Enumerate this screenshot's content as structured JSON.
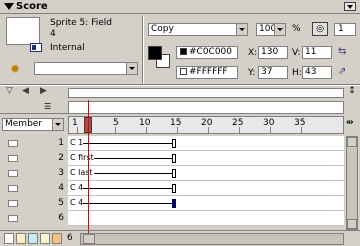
{
  "window": {
    "title": "Score"
  },
  "sprite": {
    "name": "Sprite 5: Field",
    "number": "4",
    "cast_member": "Internal",
    "behavior": ""
  },
  "ink": {
    "value": "Copy"
  },
  "blend": {
    "value": "100",
    "unit": "%"
  },
  "trails_label": "",
  "frame_field": "1",
  "colors": {
    "foreground": "#C0C000",
    "background": "#FFFFFF",
    "fg_hex": "#000000",
    "bg_hex": "#FFFFFF"
  },
  "coords": {
    "x_label": "X:",
    "x_value": "130",
    "y_label": "Y:",
    "y_value": "37",
    "v_label": "V:",
    "v_value": "11",
    "h_label": "H:",
    "h_value": "43"
  },
  "member_dropdown": "Member",
  "ruler": {
    "ticks": [
      "1",
      "5",
      "10",
      "15",
      "20",
      "25",
      "30",
      "35"
    ]
  },
  "channels": [
    {
      "num": "1",
      "label": "C 1"
    },
    {
      "num": "2",
      "label": "C first"
    },
    {
      "num": "3",
      "label": "C last"
    },
    {
      "num": "4",
      "label": "C 4"
    },
    {
      "num": "5",
      "label": "C 4"
    },
    {
      "num": "6",
      "label": ""
    }
  ],
  "bottom": {
    "frame_number": "6"
  }
}
